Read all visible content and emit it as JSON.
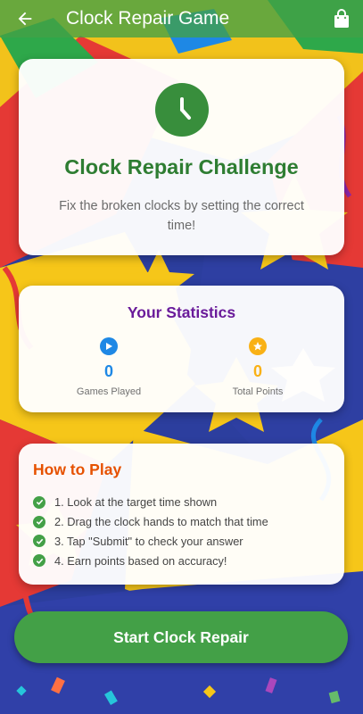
{
  "appbar": {
    "title": "Clock Repair Game"
  },
  "intro": {
    "title": "Clock Repair Challenge",
    "subtitle": "Fix the broken clocks by setting the correct time!"
  },
  "stats": {
    "title": "Your Statistics",
    "games_played": {
      "value": "0",
      "label": "Games Played",
      "color": "#1e88e5"
    },
    "total_points": {
      "value": "0",
      "label": "Total Points",
      "color": "#f9b115"
    }
  },
  "howto": {
    "title": "How to Play",
    "steps": [
      "1. Look at the target time shown",
      "2. Drag the clock hands to match that time",
      "3. Tap \"Submit\" to check your answer",
      "4. Earn points based on accuracy!"
    ]
  },
  "start_button": {
    "label": "Start Clock Repair"
  },
  "colors": {
    "primary_green": "#43a047",
    "title_green": "#2e7d32",
    "stats_purple": "#6a1b9a",
    "howto_orange": "#e65100"
  }
}
